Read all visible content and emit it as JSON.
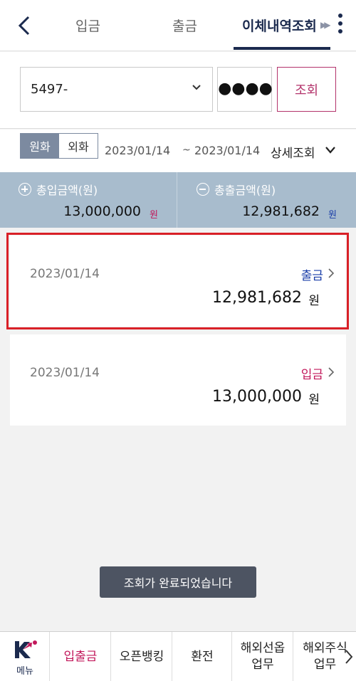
{
  "header": {
    "tabs": [
      "입금",
      "출금",
      "이체내역조회"
    ],
    "active_tab": 2
  },
  "query": {
    "account": "5497-",
    "password_mask": "●●●●",
    "query_label": "조회"
  },
  "filter": {
    "currency_won": "원화",
    "currency_foreign": "외화",
    "date_from": "2023/01/14",
    "separator": "~",
    "date_to": "2023/01/14",
    "detail_label": "상세조회"
  },
  "summary": {
    "deposit_title": "총입금액(원)",
    "deposit_amount": "13,000,000",
    "deposit_unit": "원",
    "withdraw_title": "총출금액(원)",
    "withdraw_amount": "12,981,682",
    "withdraw_unit": "원"
  },
  "transactions": [
    {
      "date": "2023/01/14",
      "type": "출금",
      "amount": "12,981,682",
      "unit": "원"
    },
    {
      "date": "2023/01/14",
      "type": "입금",
      "amount": "13,000,000",
      "unit": "원"
    }
  ],
  "toast": "조회가 완료되었습니다",
  "bottom_nav": {
    "menu_label": "메뉴",
    "items": [
      "입출금",
      "오픈뱅킹",
      "환전",
      "해외선옵\n업무",
      "해외주식\n업무"
    ]
  },
  "colors": {
    "navy": "#1b2a4e",
    "accent": "#b3336b",
    "summary_bg": "#a8bccd",
    "withdraw": "#1a3ea8",
    "deposit": "#c2185b",
    "highlight": "#d92027"
  }
}
